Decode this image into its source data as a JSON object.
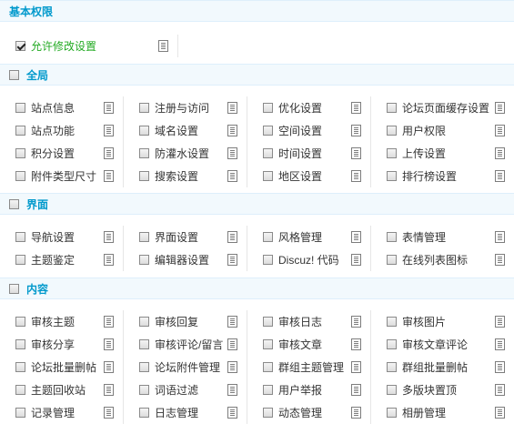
{
  "sections": {
    "basic": {
      "title": "基本权限"
    },
    "global": {
      "title": "全局"
    },
    "ui": {
      "title": "界面"
    },
    "content": {
      "title": "内容"
    }
  },
  "basic_items": [
    {
      "label": "允许修改设置",
      "checked": true
    }
  ],
  "global_items": [
    [
      "站点信息",
      "注册与访问",
      "优化设置",
      "论坛页面缓存设置"
    ],
    [
      "站点功能",
      "域名设置",
      "空间设置",
      "用户权限"
    ],
    [
      "积分设置",
      "防灌水设置",
      "时间设置",
      "上传设置"
    ],
    [
      "附件类型尺寸",
      "搜索设置",
      "地区设置",
      "排行榜设置"
    ]
  ],
  "ui_items": [
    [
      "导航设置",
      "界面设置",
      "风格管理",
      "表情管理"
    ],
    [
      "主题鉴定",
      "编辑器设置",
      "Discuz! 代码",
      "在线列表图标"
    ]
  ],
  "content_items": [
    [
      "审核主题",
      "审核回复",
      "审核日志",
      "审核图片"
    ],
    [
      "审核分享",
      "审核评论/留言",
      "审核文章",
      "审核文章评论"
    ],
    [
      "论坛批量删帖",
      "论坛附件管理",
      "群组主题管理",
      "群组批量删帖"
    ],
    [
      "主题回收站",
      "词语过滤",
      "用户举报",
      "多版块置顶"
    ],
    [
      "记录管理",
      "日志管理",
      "动态管理",
      "相册管理"
    ]
  ],
  "colors": {
    "section_title": "#0099cc",
    "section_bg": "#f2f9fd",
    "checked_label": "#22aa22"
  },
  "icons": {
    "checkbox": "checkbox-icon",
    "doc": "document-icon"
  }
}
